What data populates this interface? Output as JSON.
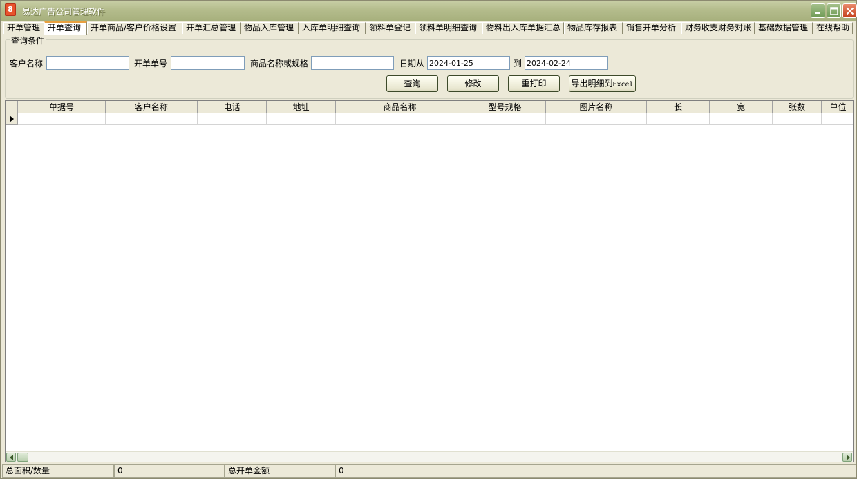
{
  "window": {
    "title": "易达广告公司管理软件",
    "icon_glyph": "8"
  },
  "tabs": [
    {
      "label": "开单管理",
      "active": false
    },
    {
      "label": "开单查询",
      "active": true
    },
    {
      "label": "开单商品/客户价格设置",
      "active": false
    },
    {
      "label": "开单汇总管理",
      "active": false
    },
    {
      "label": "物品入库管理",
      "active": false
    },
    {
      "label": "入库单明细查询",
      "active": false
    },
    {
      "label": "领料单登记",
      "active": false
    },
    {
      "label": "领料单明细查询",
      "active": false
    },
    {
      "label": "物料出入库单据汇总",
      "active": false
    },
    {
      "label": "物品库存报表",
      "active": false
    },
    {
      "label": "销售开单分析",
      "active": false
    },
    {
      "label": "财务收支财务对账",
      "active": false
    },
    {
      "label": "基础数据管理",
      "active": false
    },
    {
      "label": "在线帮助",
      "active": false
    }
  ],
  "query": {
    "legend": "查询条件",
    "customer_label": "客户名称",
    "customer_value": "",
    "order_no_label": "开单单号",
    "order_no_value": "",
    "product_label": "商品名称或规格",
    "product_value": "",
    "date_from_label": "日期从",
    "date_from_value": "2024-01-25",
    "date_to_label": "到",
    "date_to_value": "2024-02-24",
    "btn_search": "查询",
    "btn_edit": "修改",
    "btn_reprint": "重打印",
    "btn_export_prefix": "导出明细到",
    "btn_export_suffix": "Excel"
  },
  "grid": {
    "columns": [
      "单据号",
      "客户名称",
      "电话",
      "地址",
      "商品名称",
      "型号规格",
      "图片名称",
      "长",
      "宽",
      "张数",
      "单位"
    ]
  },
  "status": {
    "area_label": "总面积/数量",
    "area_value": "0",
    "amount_label": "总开单金额",
    "amount_value": "0"
  },
  "colors": {
    "titlebar": "#b4bc8c",
    "face": "#ece9d8",
    "close_button": "#c4401d",
    "active_tab_accent": "#e8a040"
  }
}
